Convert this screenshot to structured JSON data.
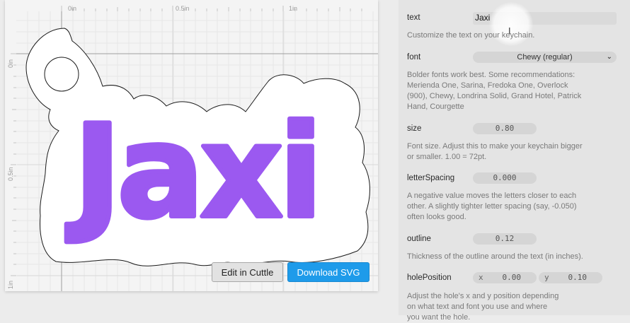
{
  "canvas": {
    "ruler": {
      "top_labels": [
        "0in",
        "0.5in",
        "1in"
      ],
      "left_labels": [
        "0in",
        "0.5in",
        "1in"
      ]
    },
    "keychain_text": "Jaxi",
    "text_color": "#9b59f0",
    "buttons": {
      "edit_label": "Edit in Cuttle",
      "download_label": "Download SVG"
    }
  },
  "params": {
    "text": {
      "label": "text",
      "value": "Jaxi",
      "description": "Customize the text on your keychain."
    },
    "font": {
      "label": "font",
      "value": "Chewy (regular)",
      "description": "Bolder fonts work best. Some recommendations: Merienda One, Sarina, Fredoka One, Overlock (900), Chewy, Londrina Solid, Grand Hotel, Patrick Hand, Courgette"
    },
    "size": {
      "label": "size",
      "value": "0.80",
      "description": "Font size. Adjust this to make your keychain bigger or smaller. 1.00 = 72pt."
    },
    "letterSpacing": {
      "label": "letterSpacing",
      "value": "0.000",
      "description": "A negative value moves the letters closer to each other. A slightly tighter letter spacing (say, -0.050) often looks good."
    },
    "outline": {
      "label": "outline",
      "value": "0.12",
      "description": "Thickness of the outline around the text (in inches)."
    },
    "holePosition": {
      "label": "holePosition",
      "x_prefix": "x",
      "x_value": "0.00",
      "y_prefix": "y",
      "y_value": "0.10",
      "description": "Adjust the hole's x and y position depending on what text and font you use and where you want the hole."
    }
  }
}
